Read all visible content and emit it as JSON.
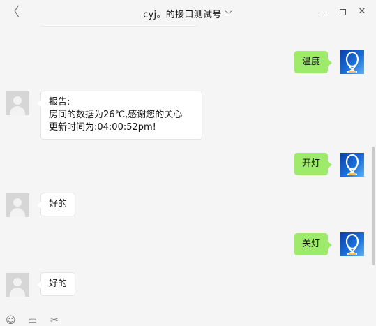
{
  "window": {
    "title": "cyj。的接口测试号",
    "back_glyph": "〈",
    "title_chevron": "﹀",
    "close_glyph": "✕"
  },
  "messages": [
    {
      "direction": "incoming",
      "text": ""
    },
    {
      "direction": "outgoing",
      "text": "温度"
    },
    {
      "direction": "incoming",
      "text": "报告:\n房间的数据为26℃,感谢您的关心\n更新时间为:04:00:52pm!"
    },
    {
      "direction": "outgoing",
      "text": "开灯"
    },
    {
      "direction": "incoming",
      "text": "好的"
    },
    {
      "direction": "outgoing",
      "text": "关灯"
    },
    {
      "direction": "incoming",
      "text": "好的"
    }
  ],
  "toolbar": {
    "emoji_glyph": "☺",
    "folder_glyph": "▭",
    "scissors_glyph": "✂"
  },
  "colors": {
    "outgoing_bubble": "#9eea6a",
    "incoming_bubble": "#ffffff",
    "background": "#f5f5f5"
  }
}
